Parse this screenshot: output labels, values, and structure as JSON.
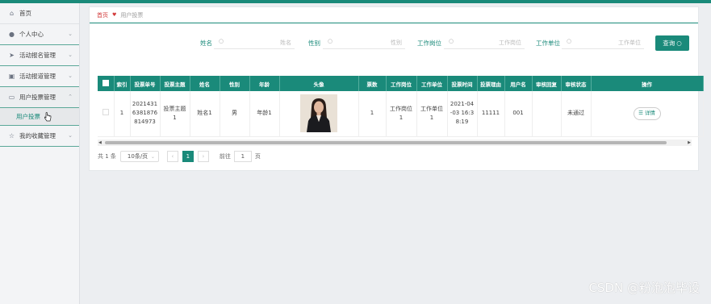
{
  "sidebar": {
    "items": [
      {
        "label": "首页",
        "icon": "home-icon"
      },
      {
        "label": "个人中心",
        "icon": "user-icon"
      },
      {
        "label": "活动报名管理",
        "icon": "send-icon"
      },
      {
        "label": "活动报道管理",
        "icon": "image-icon"
      },
      {
        "label": "用户投票管理",
        "icon": "card-icon"
      },
      {
        "label": "我的收藏管理",
        "icon": "star-icon"
      }
    ],
    "sub_item": "用户投票"
  },
  "breadcrumb": {
    "home": "首页",
    "current": "用户投票"
  },
  "search": {
    "fields": [
      {
        "label": "姓名",
        "placeholder": "姓名"
      },
      {
        "label": "性别",
        "placeholder": "性别"
      },
      {
        "label": "工作岗位",
        "placeholder": "工作岗位"
      },
      {
        "label": "工作单位",
        "placeholder": "工作单位"
      }
    ],
    "button": "查询"
  },
  "table": {
    "headers": [
      "索引",
      "投票单号",
      "投票主题",
      "姓名",
      "性别",
      "年龄",
      "头像",
      "票数",
      "工作岗位",
      "工作单位",
      "投票时间",
      "投票理由",
      "用户名",
      "审核回复",
      "审核状态",
      "操作"
    ],
    "row": {
      "index": "1",
      "order_no": "2021431638187681 4973",
      "order_no_lines": [
        "2021431",
        "6381876",
        "814973"
      ],
      "topic_lines": [
        "投票主题",
        "1"
      ],
      "name": "姓名1",
      "gender": "男",
      "age": "年龄1",
      "votes": "1",
      "post_lines": [
        "工作岗位",
        "1"
      ],
      "unit_lines": [
        "工作单位",
        "1"
      ],
      "time_lines": [
        "2021-04",
        "-03 16:3",
        "8:19"
      ],
      "reason": "11111",
      "username": "001",
      "reply": "",
      "status": "未通过",
      "action": "详情"
    }
  },
  "pagination": {
    "total": "共 1 条",
    "page_size": "10条/页",
    "current_page": "1",
    "goto_label": "前往",
    "goto_value": "1",
    "page_suffix": "页"
  },
  "watermark": "CSDN @粉泡泡毕设",
  "colors": {
    "accent": "#1a8a7a",
    "breadcrumb_home": "#d23a3a"
  }
}
